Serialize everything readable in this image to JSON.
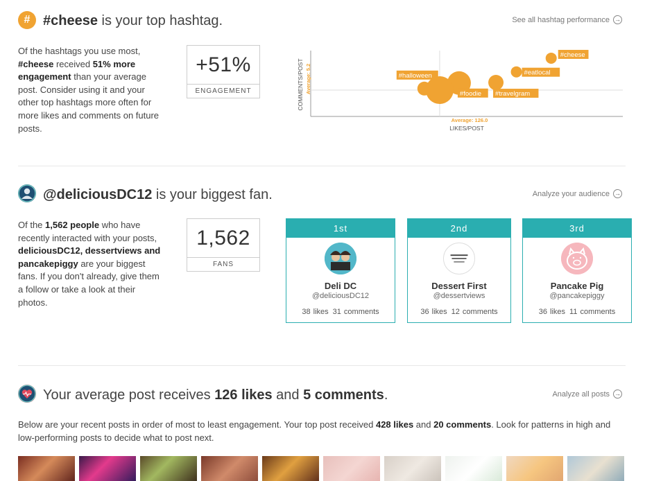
{
  "hashtag": {
    "icon_glyph": "#",
    "title_strong": "#cheese",
    "title_rest": " is your top hashtag.",
    "link_label": "See all hashtag performance",
    "para": {
      "p1": "Of the hashtags you use most, ",
      "b1": "#cheese",
      "p2": " received ",
      "b2": "51% more engagement",
      "p3": " than your average post. Consider using it and your other top hashtags more often for more likes and comments on future posts."
    },
    "stat_value": "+51%",
    "stat_label": "ENGAGEMENT"
  },
  "chart_data": {
    "type": "scatter",
    "xlabel": "LIKES/POST",
    "ylabel": "COMMENTS/POST",
    "x_avg_label": "Average: 126.0",
    "y_avg_label": "Average: 5.2",
    "x_avg": 126.0,
    "y_avg": 5.2,
    "xlim": [
      0,
      305
    ],
    "ylim": [
      0,
      13
    ],
    "accent": "#f0a332",
    "points": [
      {
        "label": "#cheese",
        "x": 235,
        "y": 11.5,
        "size": 16
      },
      {
        "label": "#halloween",
        "x": 111,
        "y": 5.5,
        "size": 20
      },
      {
        "label": "#eatlocal",
        "x": 201,
        "y": 8.8,
        "size": 16
      },
      {
        "label": "#foodie",
        "x": 145,
        "y": 6.6,
        "size": 34
      },
      {
        "label": "#travelgram",
        "x": 181,
        "y": 6.7,
        "size": 22
      },
      {
        "label": "",
        "x": 126,
        "y": 5.2,
        "size": 40
      }
    ]
  },
  "fans": {
    "title_strong": "@deliciousDC12",
    "title_rest": " is your biggest fan.",
    "link_label": "Analyze your audience",
    "para": {
      "p1": "Of the ",
      "b1": "1,562 people",
      "p2": " who have recently interacted with your posts, ",
      "b2": "deliciousDC12, dessertviews and pancakepiggy",
      "p3": " are your biggest fans. If you don't already, give them a follow or take a look at their photos."
    },
    "stat_value": "1,562",
    "stat_label": "FANS",
    "cards": [
      {
        "rank": "1st",
        "name": "Deli DC",
        "handle": "@deliciousDC12",
        "likes": "38 likes",
        "comments": "31 comments"
      },
      {
        "rank": "2nd",
        "name": "Dessert First",
        "handle": "@dessertviews",
        "likes": "36 likes",
        "comments": "12 comments"
      },
      {
        "rank": "3rd",
        "name": "Pancake Pig",
        "handle": "@pancakepiggy",
        "likes": "36 likes",
        "comments": "11 comments"
      }
    ]
  },
  "average": {
    "title_p1": "Your average post receives ",
    "title_b1": "126 likes",
    "title_p2": " and ",
    "title_b2": "5 comments",
    "title_p3": ".",
    "link_label": "Analyze all posts",
    "para": {
      "p1": "Below are your recent posts in order of most to least engagement. Your top post received ",
      "b1": "428 likes",
      "p2": " and ",
      "b2": "20 comments",
      "p3": ". Look for patterns in high and low-performing posts to decide what to post next."
    }
  }
}
